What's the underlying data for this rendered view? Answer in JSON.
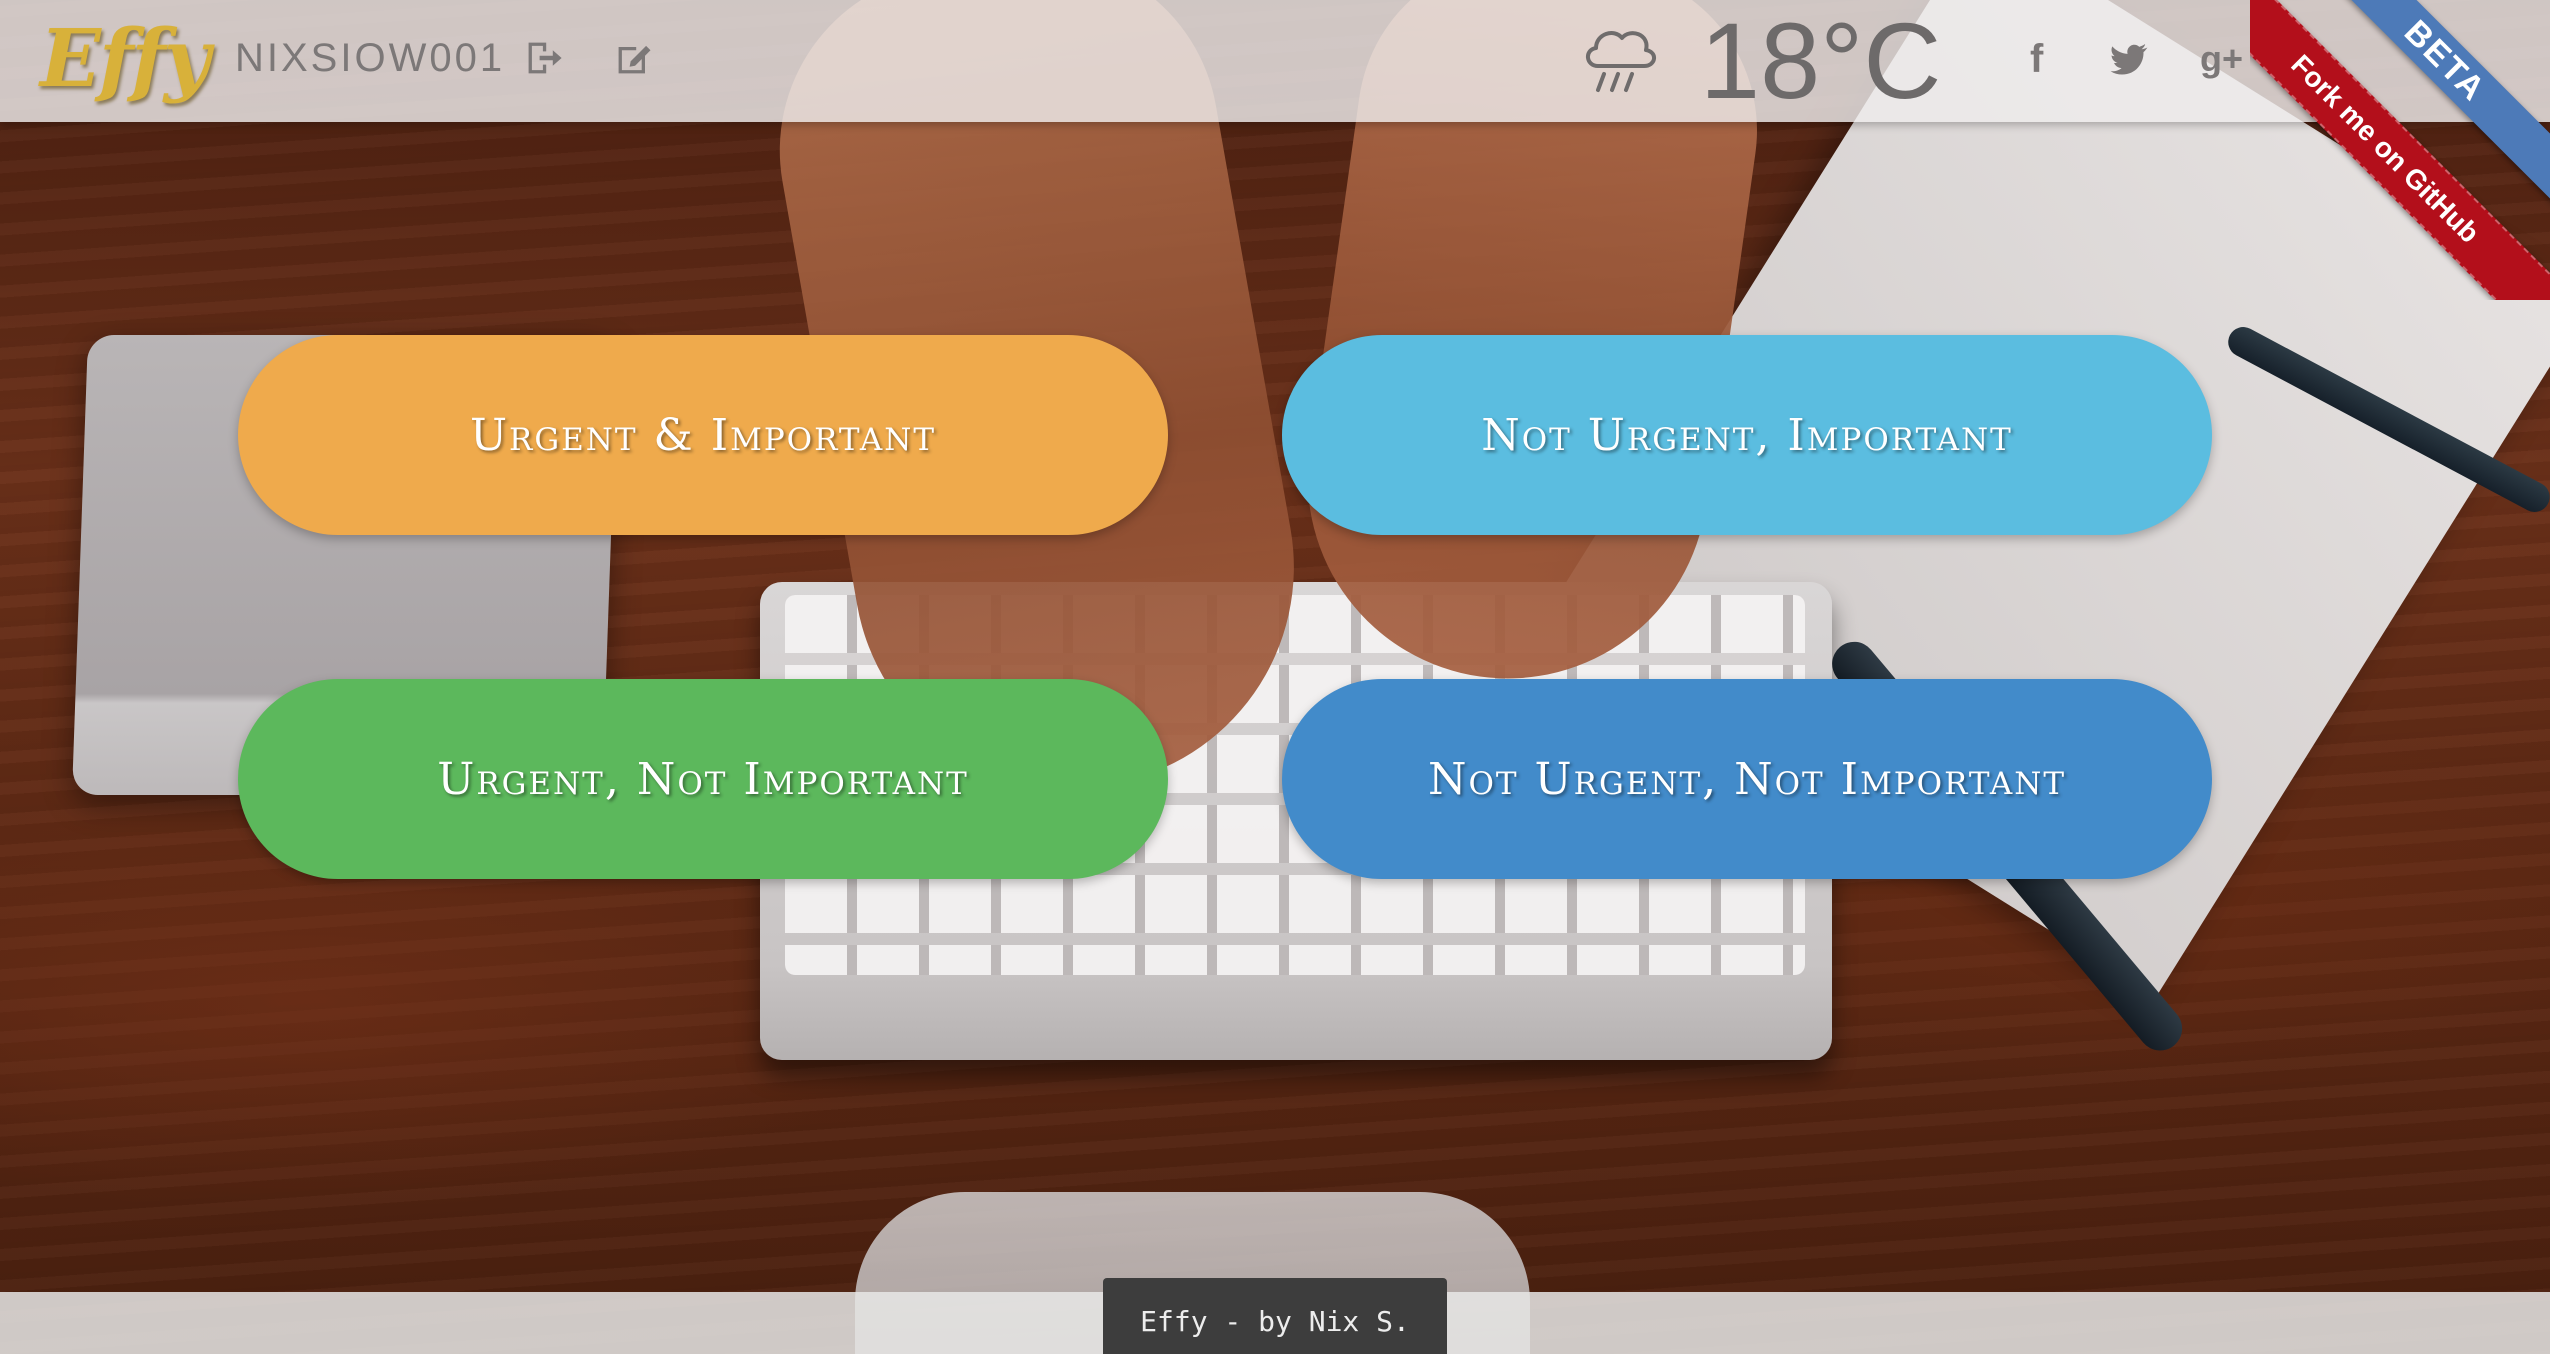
{
  "header": {
    "logo_text": "Effy",
    "username": "NIXSIOW001",
    "weather_icon": "cloud-rain-icon",
    "temperature": "18°C",
    "social": {
      "facebook": "f",
      "twitter": "twitter-bird-icon",
      "gplus": "g+"
    }
  },
  "ribbons": {
    "github": "Fork me on GitHub",
    "beta": "BETA"
  },
  "quadrants": [
    {
      "label": "Urgent & Important",
      "color": "#efaa4c"
    },
    {
      "label": "Not Urgent, Important",
      "color": "#5bbde0"
    },
    {
      "label": "Urgent, Not Important",
      "color": "#5cb85c"
    },
    {
      "label": "Not Urgent, Not Important",
      "color": "#428bca"
    }
  ],
  "footer": {
    "credit": "Effy - by Nix S."
  }
}
